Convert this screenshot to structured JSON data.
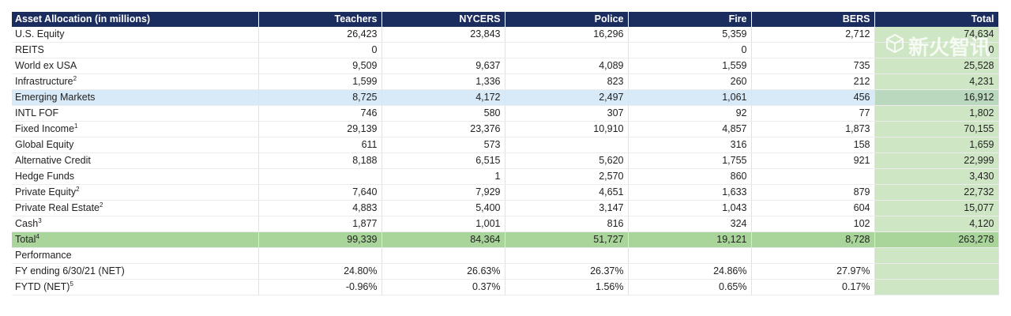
{
  "table": {
    "headers": [
      "Asset Allocation (in millions)",
      "Teachers",
      "NYCERS",
      "Police",
      "Fire",
      "BERS",
      "Total"
    ],
    "rows": [
      {
        "label": "U.S. Equity",
        "sup": "",
        "values": [
          "26,423",
          "23,843",
          "16,296",
          "5,359",
          "2,712",
          "74,634"
        ]
      },
      {
        "label": "REITS",
        "sup": "",
        "values": [
          "0",
          "",
          "",
          "0",
          "",
          "0"
        ]
      },
      {
        "label": "World ex USA",
        "sup": "",
        "values": [
          "9,509",
          "9,637",
          "4,089",
          "1,559",
          "735",
          "25,528"
        ]
      },
      {
        "label": "Infrastructure",
        "sup": "2",
        "values": [
          "1,599",
          "1,336",
          "823",
          "260",
          "212",
          "4,231"
        ]
      },
      {
        "label": "Emerging Markets",
        "sup": "",
        "values": [
          "8,725",
          "4,172",
          "2,497",
          "1,061",
          "456",
          "16,912"
        ],
        "style": "highlight"
      },
      {
        "label": "INTL FOF",
        "sup": "",
        "values": [
          "746",
          "580",
          "307",
          "92",
          "77",
          "1,802"
        ]
      },
      {
        "label": "Fixed Income",
        "sup": "1",
        "values": [
          "29,139",
          "23,376",
          "10,910",
          "4,857",
          "1,873",
          "70,155"
        ]
      },
      {
        "label": "Global Equity",
        "sup": "",
        "values": [
          "611",
          "573",
          "",
          "316",
          "158",
          "1,659"
        ]
      },
      {
        "label": "Alternative Credit",
        "sup": "",
        "values": [
          "8,188",
          "6,515",
          "5,620",
          "1,755",
          "921",
          "22,999"
        ]
      },
      {
        "label": "Hedge Funds",
        "sup": "",
        "values": [
          "",
          "1",
          "2,570",
          "860",
          "",
          "3,430"
        ]
      },
      {
        "label": "Private Equity",
        "sup": "2",
        "values": [
          "7,640",
          "7,929",
          "4,651",
          "1,633",
          "879",
          "22,732"
        ]
      },
      {
        "label": "Private Real Estate",
        "sup": "2",
        "values": [
          "4,883",
          "5,400",
          "3,147",
          "1,043",
          "604",
          "15,077"
        ]
      },
      {
        "label": "Cash",
        "sup": "3",
        "values": [
          "1,877",
          "1,001",
          "816",
          "324",
          "102",
          "4,120"
        ]
      },
      {
        "label": "Total",
        "sup": "4",
        "values": [
          "99,339",
          "84,364",
          "51,727",
          "19,121",
          "8,728",
          "263,278"
        ],
        "style": "total"
      },
      {
        "label": "Performance",
        "sup": "",
        "values": [
          "",
          "",
          "",
          "",
          "",
          ""
        ]
      },
      {
        "label": "FY ending 6/30/21 (NET)",
        "sup": "",
        "values": [
          "24.80%",
          "26.63%",
          "26.37%",
          "24.86%",
          "27.97%",
          ""
        ]
      },
      {
        "label": "FYTD (NET)",
        "sup": "5",
        "values": [
          "-0.96%",
          "0.37%",
          "1.56%",
          "0.65%",
          "0.17%",
          ""
        ]
      }
    ]
  },
  "watermark": {
    "icon": "cube-logo-icon",
    "text": "新火智讯"
  }
}
